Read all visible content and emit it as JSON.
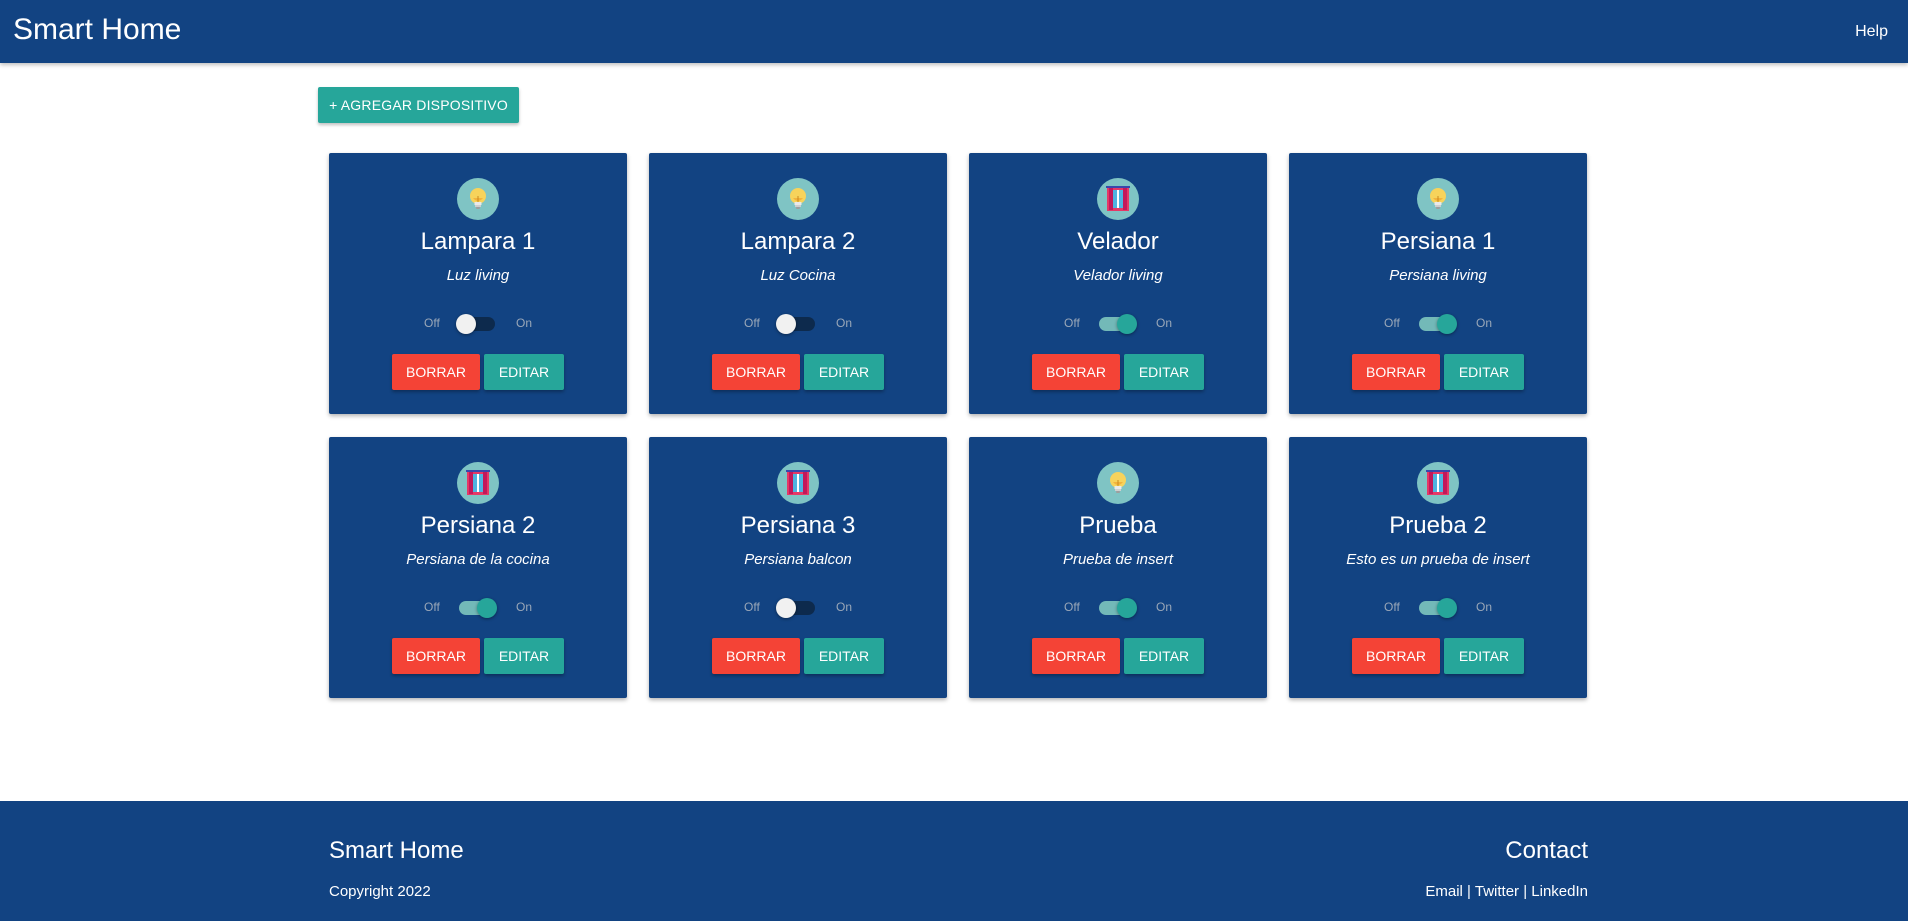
{
  "navbar": {
    "brand": "Smart Home",
    "help": "Help"
  },
  "add_button": {
    "label": "+ AGREGAR DISPOSITIVO"
  },
  "devices": [
    {
      "name": "Lampara 1",
      "description": "Luz living",
      "icon": "lightbulb-icon",
      "state": "off"
    },
    {
      "name": "Lampara 2",
      "description": "Luz Cocina",
      "icon": "lightbulb-icon",
      "state": "off"
    },
    {
      "name": "Velador",
      "description": "Velador living",
      "icon": "window-blind-icon",
      "state": "on"
    },
    {
      "name": "Persiana 1",
      "description": "Persiana living",
      "icon": "lightbulb-icon",
      "state": "on"
    },
    {
      "name": "Persiana 2",
      "description": "Persiana de la cocina",
      "icon": "window-blind-icon",
      "state": "on"
    },
    {
      "name": "Persiana 3",
      "description": "Persiana balcon",
      "icon": "window-blind-icon",
      "state": "off"
    },
    {
      "name": "Prueba",
      "description": "Prueba de insert",
      "icon": "lightbulb-icon",
      "state": "on"
    },
    {
      "name": "Prueba 2",
      "description": "Esto es un prueba de insert",
      "icon": "window-blind-icon",
      "state": "on"
    }
  ],
  "switch_labels": {
    "off": "Off",
    "on": "On"
  },
  "card_buttons": {
    "delete": "BORRAR",
    "edit": "EDITAR"
  },
  "footer": {
    "title": "Smart Home",
    "copyright": "Copyright 2022",
    "contact_title": "Contact",
    "links": [
      "Email",
      "Twitter",
      "LinkedIn"
    ],
    "separator": " | "
  },
  "colors": {
    "primary": "#124382",
    "accent": "#26a69a",
    "danger": "#f44336",
    "icon_bg": "#7fc4c4"
  }
}
